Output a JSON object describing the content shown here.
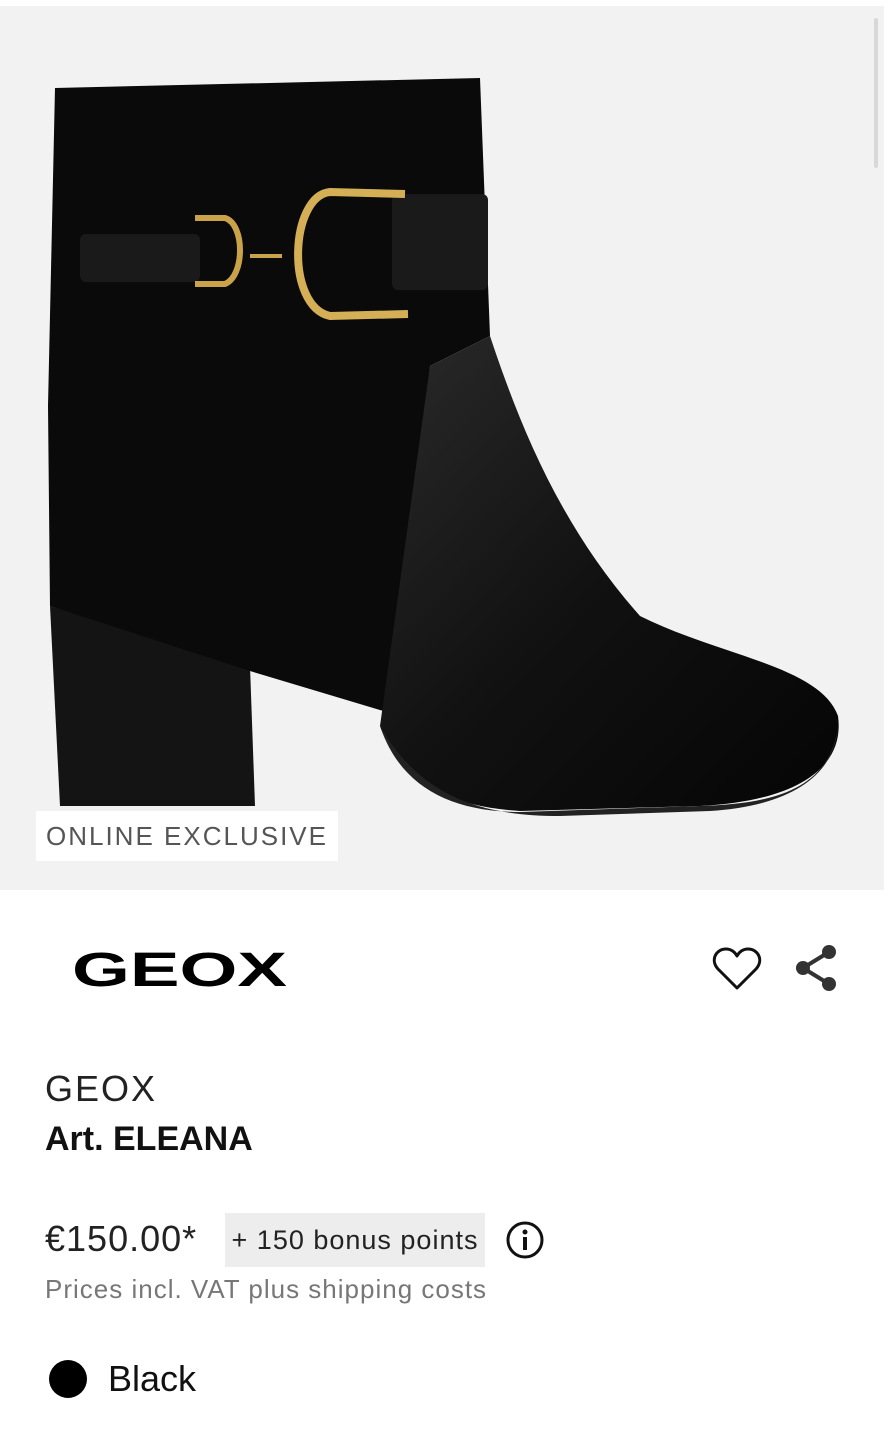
{
  "hero": {
    "badge": "ONLINE EXCLUSIVE",
    "image_icon": "ankle-boot-image"
  },
  "brand_row": {
    "logo_text": "GEOX",
    "favorite_icon": "heart-icon",
    "share_icon": "share-icon"
  },
  "product": {
    "brand": "GEOX",
    "title": "Art. ELEANA",
    "price": "€150.00*",
    "bonus": "+ 150 bonus points",
    "info_icon": "info-icon",
    "vat_note": "Prices incl. VAT plus shipping costs",
    "color": {
      "label": "Black",
      "swatch": "#000000"
    }
  }
}
